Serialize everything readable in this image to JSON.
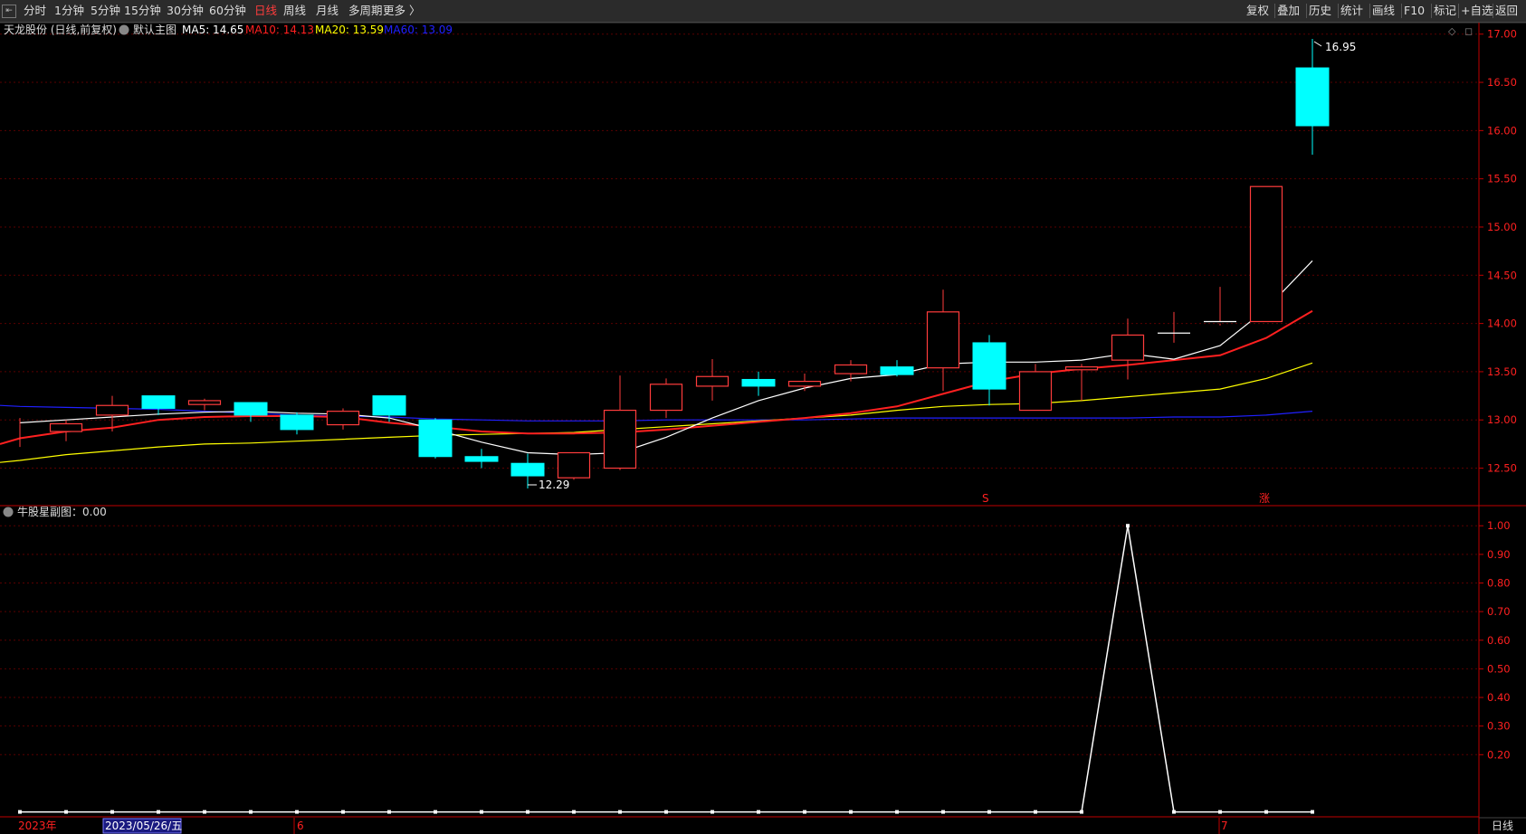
{
  "toolbar": {
    "left": [
      "分时",
      "1分钟",
      "5分钟",
      "15分钟",
      "30分钟",
      "60分钟",
      "日线",
      "周线",
      "月线",
      "多周期",
      "更多 〉"
    ],
    "active": "日线",
    "right": [
      "复权",
      "叠加",
      "历史",
      "统计",
      "画线",
      "F10",
      "标记",
      "+自选",
      "返回"
    ]
  },
  "main_header": {
    "title": "天龙股份 (日线,前复权)",
    "indicator": "默认主图",
    "ma": [
      {
        "label": "MA5: 14.65",
        "color": "#ffffff"
      },
      {
        "label": "MA10: 14.13",
        "color": "#ff2020"
      },
      {
        "label": "MA20: 13.59",
        "color": "#ffff00"
      },
      {
        "label": "MA60: 13.09",
        "color": "#2020ff"
      }
    ]
  },
  "sub_header": {
    "title": "牛股星副图：0.00"
  },
  "annotations": {
    "high": "16.95",
    "low": "12.29",
    "marker_s": "S",
    "marker_zhang": "涨"
  },
  "xaxis": {
    "year": "2023年",
    "date_box": "2023/05/26/五",
    "m6": "6",
    "m7": "7"
  },
  "period_label": "日线",
  "colors": {
    "up": "#ff3c3c",
    "down": "#00ffff",
    "grid": "#5a0000",
    "axis": "#c00000"
  },
  "chart_data": [
    {
      "type": "candlestick",
      "title": "天龙股份 (日线,前复权)",
      "y_ticks": [
        "17.00",
        "16.50",
        "16.00",
        "15.50",
        "15.00",
        "14.50",
        "14.00",
        "13.50",
        "13.00",
        "12.50"
      ],
      "ylim": [
        12.13,
        17.11
      ],
      "candles": [
        {
          "o": 12.95,
          "h": 13.02,
          "l": 12.72,
          "c": 12.95
        },
        {
          "o": 12.88,
          "h": 13.0,
          "l": 12.78,
          "c": 12.96
        },
        {
          "o": 13.05,
          "h": 13.25,
          "l": 12.88,
          "c": 13.15
        },
        {
          "o": 13.25,
          "h": 13.25,
          "l": 13.05,
          "c": 13.12
        },
        {
          "o": 13.16,
          "h": 13.22,
          "l": 13.1,
          "c": 13.2
        },
        {
          "o": 13.18,
          "h": 13.18,
          "l": 12.98,
          "c": 13.05
        },
        {
          "o": 13.05,
          "h": 13.08,
          "l": 12.85,
          "c": 12.9
        },
        {
          "o": 12.95,
          "h": 13.12,
          "l": 12.9,
          "c": 13.09
        },
        {
          "o": 13.25,
          "h": 13.25,
          "l": 12.98,
          "c": 13.05
        },
        {
          "o": 13.0,
          "h": 13.02,
          "l": 12.6,
          "c": 12.62
        },
        {
          "o": 12.62,
          "h": 12.7,
          "l": 12.5,
          "c": 12.57
        },
        {
          "o": 12.55,
          "h": 12.65,
          "l": 12.29,
          "c": 12.42
        },
        {
          "o": 12.4,
          "h": 12.66,
          "l": 12.38,
          "c": 12.66
        },
        {
          "o": 12.5,
          "h": 13.46,
          "l": 12.48,
          "c": 13.1
        },
        {
          "o": 13.1,
          "h": 13.43,
          "l": 13.02,
          "c": 13.37
        },
        {
          "o": 13.35,
          "h": 13.63,
          "l": 13.2,
          "c": 13.45
        },
        {
          "o": 13.42,
          "h": 13.5,
          "l": 13.25,
          "c": 13.35
        },
        {
          "o": 13.35,
          "h": 13.48,
          "l": 13.3,
          "c": 13.4
        },
        {
          "o": 13.48,
          "h": 13.62,
          "l": 13.4,
          "c": 13.57
        },
        {
          "o": 13.55,
          "h": 13.62,
          "l": 13.45,
          "c": 13.47
        },
        {
          "o": 13.54,
          "h": 14.35,
          "l": 13.3,
          "c": 14.12
        },
        {
          "o": 13.8,
          "h": 13.88,
          "l": 13.15,
          "c": 13.32
        },
        {
          "o": 13.1,
          "h": 13.58,
          "l": 13.1,
          "c": 13.5
        },
        {
          "o": 13.52,
          "h": 13.58,
          "l": 13.2,
          "c": 13.55
        },
        {
          "o": 13.62,
          "h": 14.05,
          "l": 13.42,
          "c": 13.88
        },
        {
          "o": 13.9,
          "h": 14.12,
          "l": 13.8,
          "c": 13.9
        },
        {
          "o": 14.0,
          "h": 14.38,
          "l": 13.98,
          "c": 14.02
        },
        {
          "o": 14.02,
          "h": 15.42,
          "l": 14.02,
          "c": 15.42
        },
        {
          "o": 16.65,
          "h": 16.95,
          "l": 15.75,
          "c": 16.05
        }
      ],
      "ma5": [
        12.97,
        13.0,
        13.03,
        13.06,
        13.08,
        13.09,
        13.07,
        13.06,
        13.02,
        12.9,
        12.77,
        12.66,
        12.64,
        12.66,
        12.82,
        13.02,
        13.2,
        13.33,
        13.43,
        13.47,
        13.58,
        13.6,
        13.6,
        13.62,
        13.69,
        13.63,
        13.77,
        14.15,
        14.65
      ],
      "ma10": [
        12.75,
        12.81,
        12.88,
        12.92,
        13.0,
        13.03,
        13.04,
        13.04,
        13.03,
        12.97,
        12.93,
        12.88,
        12.86,
        12.86,
        12.87,
        12.9,
        12.94,
        12.98,
        13.02,
        13.07,
        13.14,
        13.27,
        13.4,
        13.48,
        13.53,
        13.57,
        13.62,
        13.67,
        13.85,
        14.13
      ],
      "ma20": [
        12.56,
        12.58,
        12.64,
        12.68,
        12.72,
        12.75,
        12.76,
        12.78,
        12.8,
        12.82,
        12.84,
        12.85,
        12.86,
        12.87,
        12.9,
        12.93,
        12.96,
        12.99,
        13.02,
        13.05,
        13.1,
        13.14,
        13.16,
        13.17,
        13.2,
        13.24,
        13.28,
        13.32,
        13.43,
        13.59
      ],
      "ma60": [
        13.15,
        13.14,
        13.13,
        13.12,
        13.11,
        13.09,
        13.07,
        13.05,
        13.04,
        13.03,
        13.01,
        13.0,
        12.99,
        12.99,
        12.99,
        13.0,
        13.0,
        13.0,
        13.0,
        13.01,
        13.02,
        13.02,
        13.02,
        13.02,
        13.02,
        13.02,
        13.03,
        13.03,
        13.05,
        13.09
      ],
      "series_names": [
        "MA5",
        "MA10",
        "MA20",
        "MA60"
      ]
    },
    {
      "type": "line",
      "title": "牛股星副图：0.00",
      "y_ticks": [
        "1.00",
        "0.90",
        "0.80",
        "0.70",
        "0.60",
        "0.50",
        "0.40",
        "0.30",
        "0.20"
      ],
      "ylim": [
        -0.014,
        1.064
      ],
      "values": [
        0,
        0,
        0,
        0,
        0,
        0,
        0,
        0,
        0,
        0,
        0,
        0,
        0,
        0,
        0,
        0,
        0,
        0,
        0,
        0,
        0,
        0,
        0,
        0,
        1,
        0,
        0,
        0,
        0
      ]
    }
  ]
}
